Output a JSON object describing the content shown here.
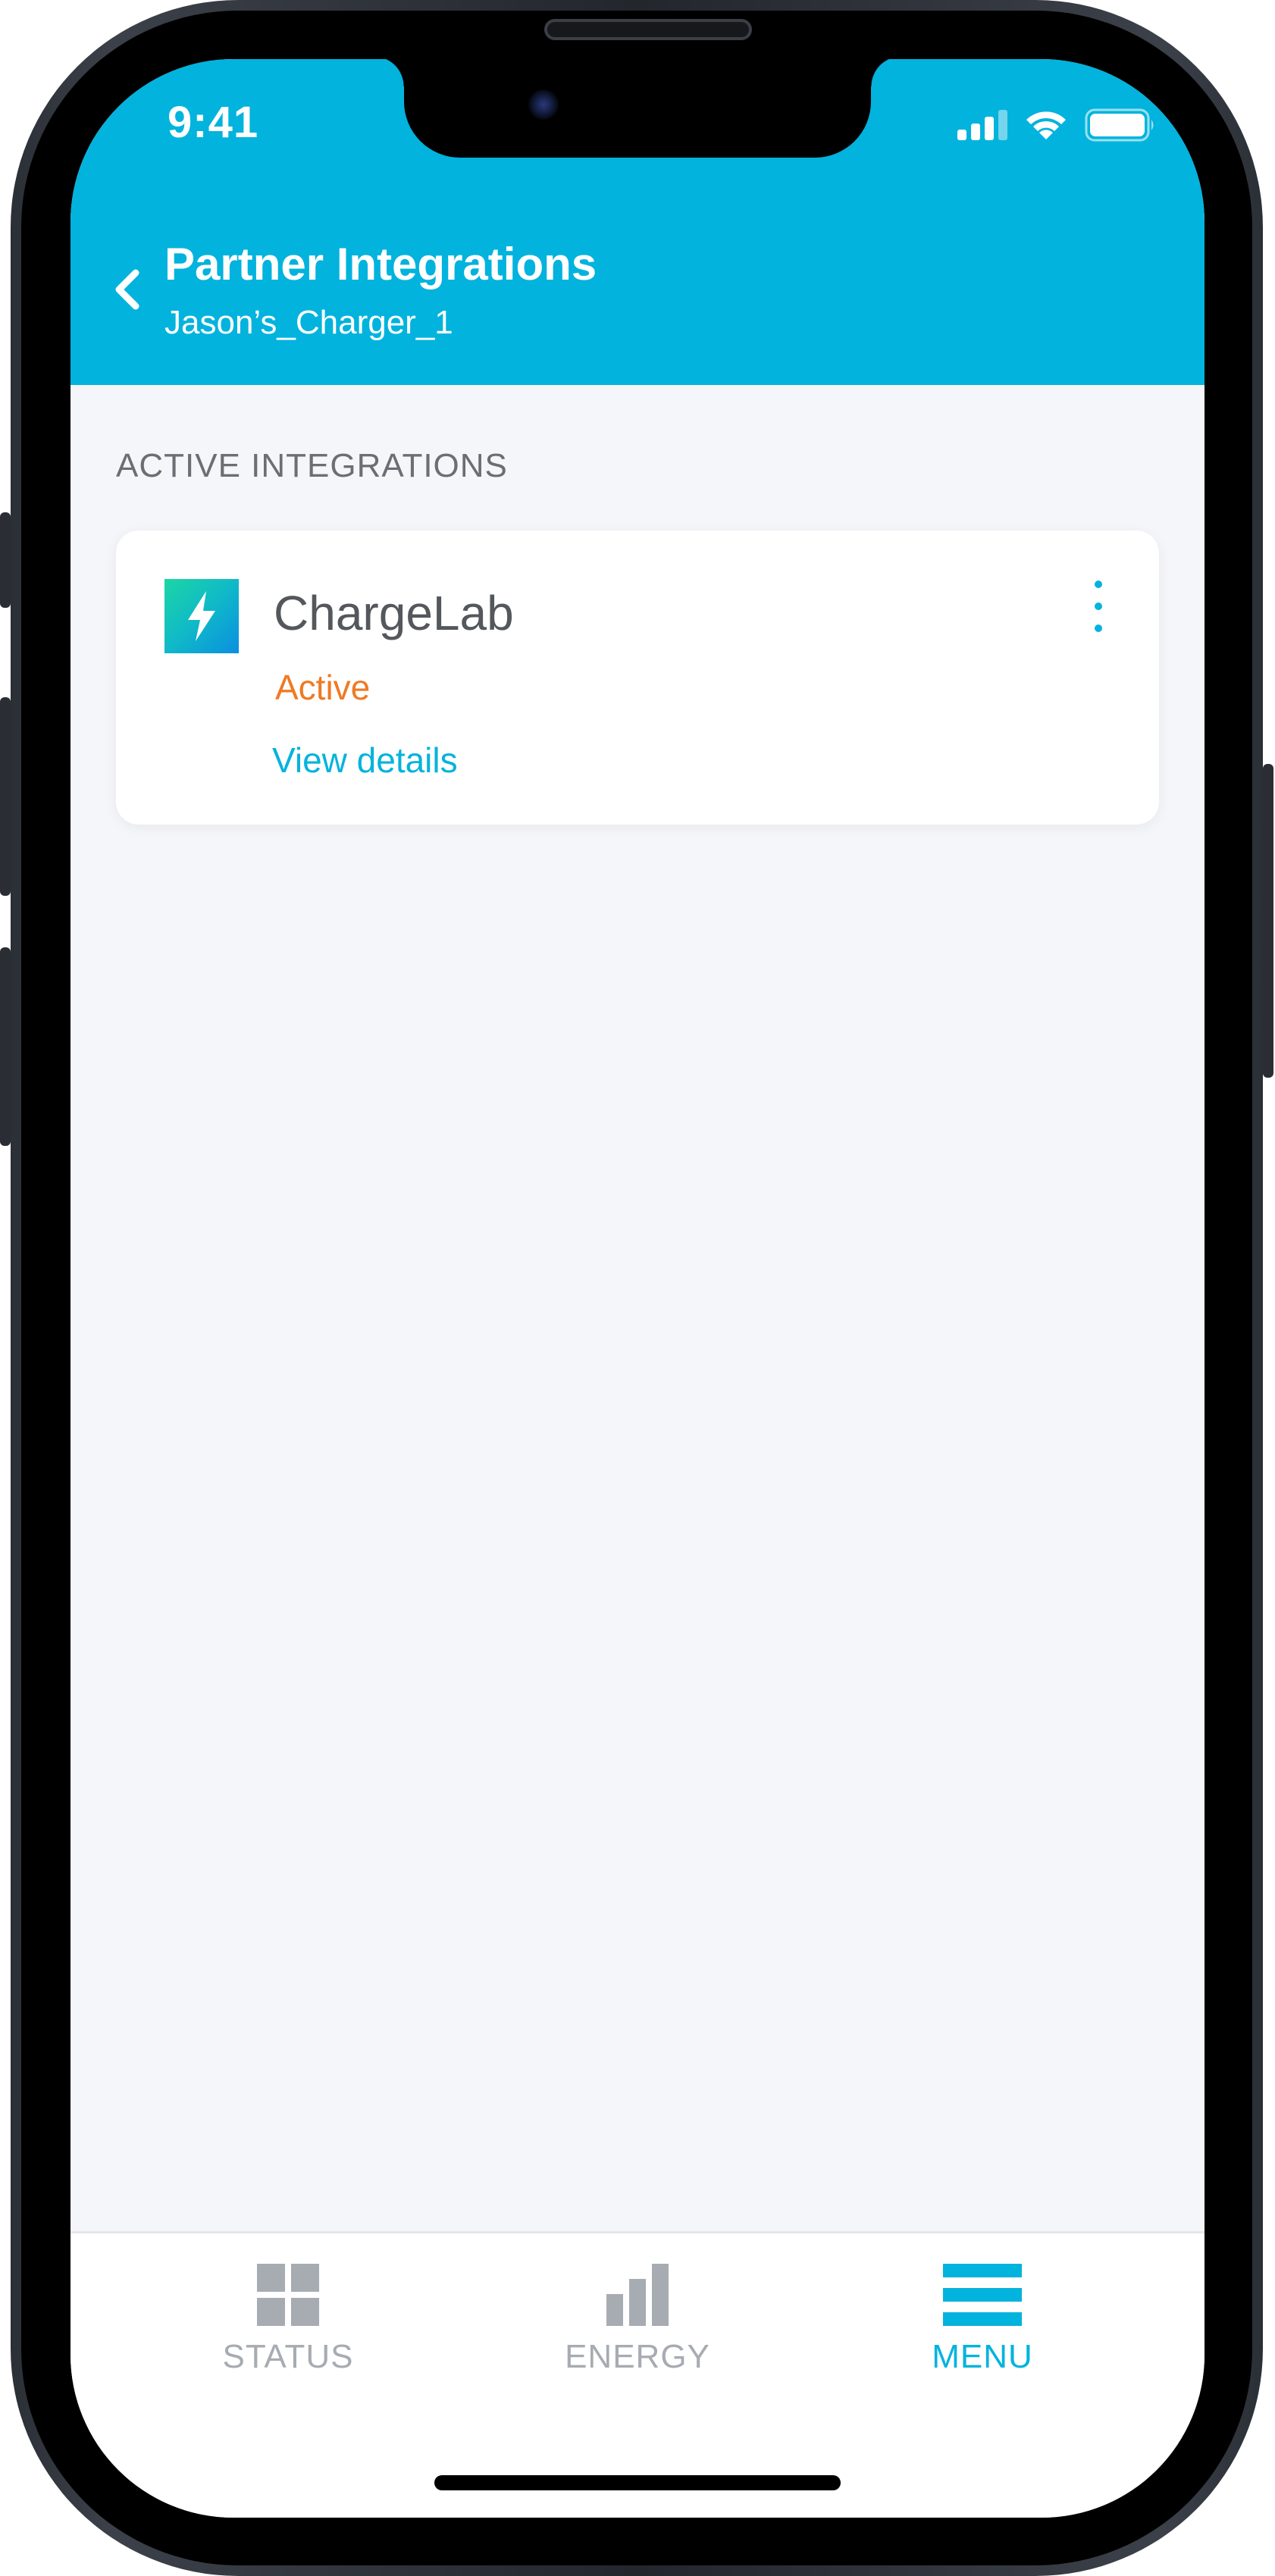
{
  "status_bar": {
    "time": "9:41"
  },
  "header": {
    "title": "Partner Integrations",
    "subtitle": "Jason’s_Charger_1"
  },
  "section": {
    "label": "ACTIVE INTEGRATIONS"
  },
  "integrations": [
    {
      "name": "ChargeLab",
      "status": "Active",
      "link_label": "View details"
    }
  ],
  "bottom_nav": {
    "items": [
      {
        "label": "STATUS",
        "icon": "grid-icon",
        "active": false
      },
      {
        "label": "ENERGY",
        "icon": "bar-chart-icon",
        "active": false
      },
      {
        "label": "MENU",
        "icon": "menu-icon",
        "active": true
      }
    ]
  },
  "colors": {
    "brand": "#02b3dd",
    "status_active": "#ef7a24",
    "nav_inactive": "#a7abb2",
    "background": "#f5f6f9"
  }
}
